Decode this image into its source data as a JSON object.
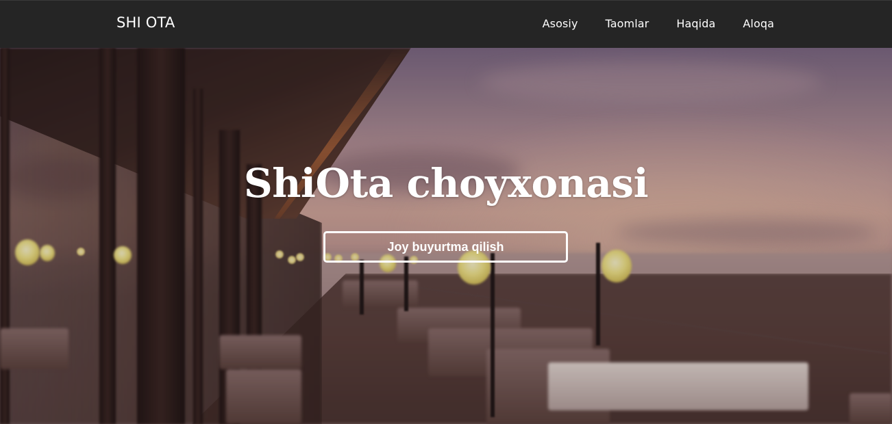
{
  "navbar": {
    "brand": "SHI OTA",
    "links": [
      {
        "label": "Asosiy"
      },
      {
        "label": "Taomlar"
      },
      {
        "label": "Haqida"
      },
      {
        "label": "Aloqa"
      }
    ]
  },
  "hero": {
    "title": "ShiOta choyxonasi",
    "button_label": "Joy buyurtma qilish"
  },
  "colors": {
    "navbar_bg": "#252525",
    "text": "#ffffff"
  }
}
